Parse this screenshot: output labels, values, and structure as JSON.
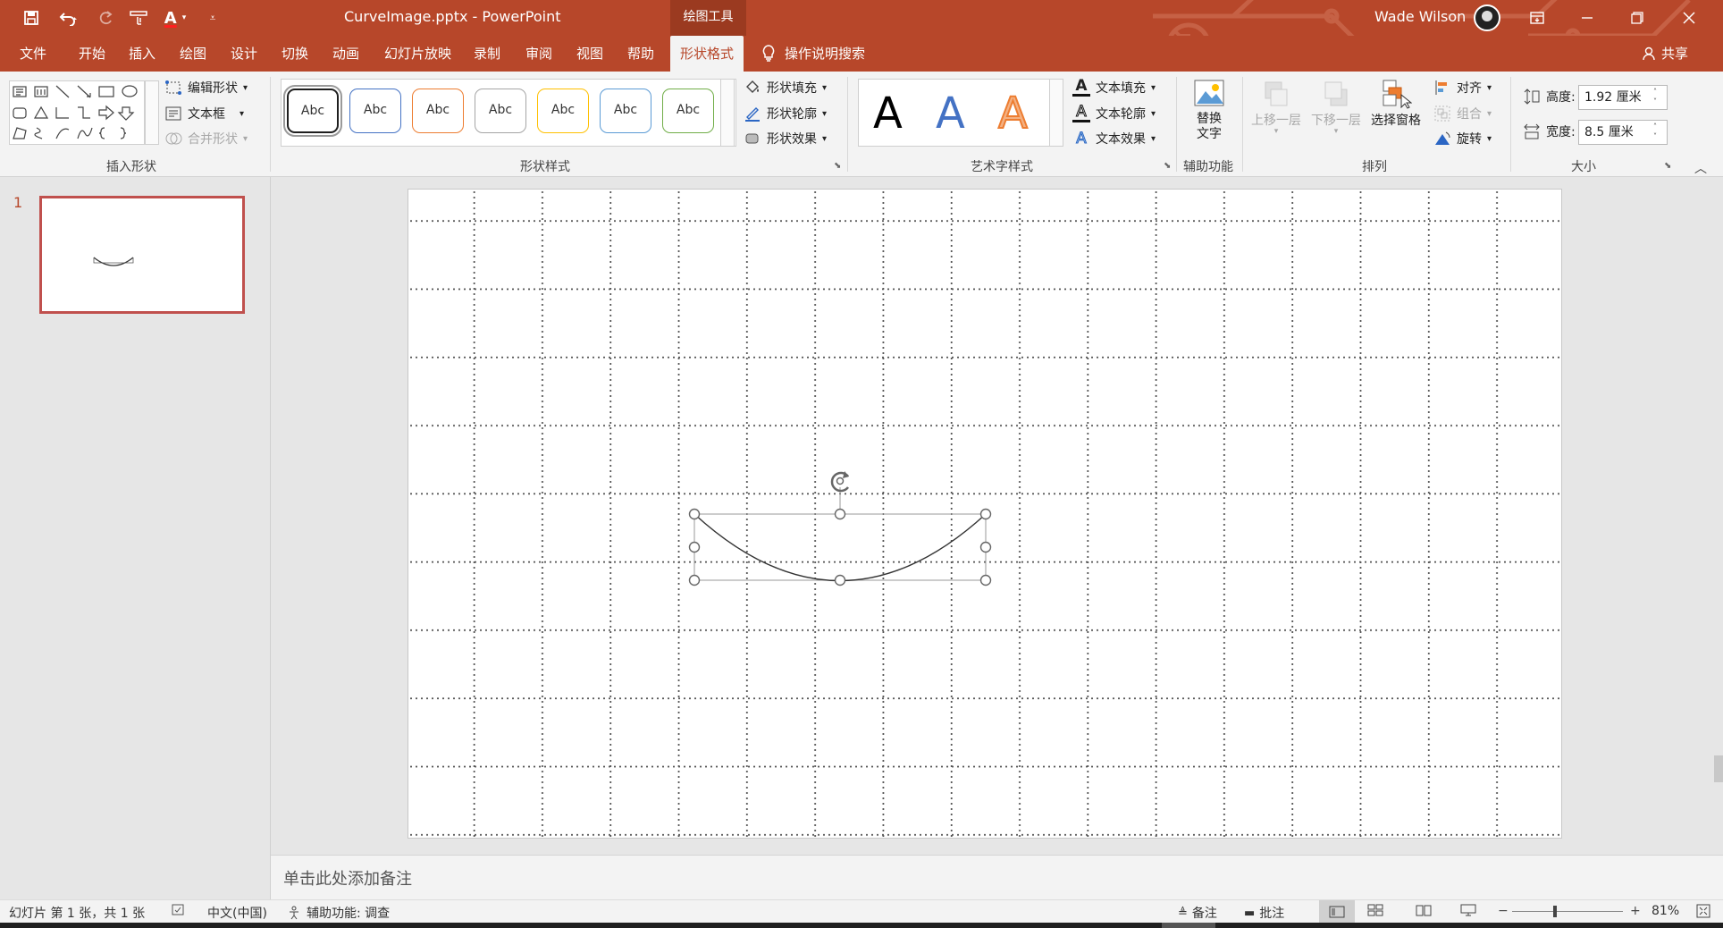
{
  "titlebar": {
    "doc_title": "CurveImage.pptx  -  PowerPoint",
    "context_tab": "绘图工具",
    "user_name": "Wade Wilson",
    "quick_access": [
      "save-icon",
      "undo-icon",
      "redo-icon",
      "touch-mode-icon",
      "font-color-icon",
      "customize-icon"
    ]
  },
  "tabs": [
    "文件",
    "开始",
    "插入",
    "绘图",
    "设计",
    "切换",
    "动画",
    "幻灯片放映",
    "录制",
    "审阅",
    "视图",
    "帮助",
    "形状格式"
  ],
  "active_tab": "形状格式",
  "tell_me": "操作说明搜索",
  "share": "共享",
  "ribbon": {
    "insert_shapes": {
      "label": "插入形状",
      "edit_shape": "编辑形状",
      "text_box": "文本框",
      "merge_shapes": "合并形状"
    },
    "shape_styles": {
      "label": "形状样式",
      "sample_text": "Abc",
      "style_colors": [
        "#1f1f1f",
        "#4472c4",
        "#ed7d31",
        "#a5a5a5",
        "#ffc000",
        "#5b9bd5",
        "#70ad47"
      ],
      "fill": "形状填充",
      "outline": "形状轮廓",
      "effects": "形状效果"
    },
    "wordart_styles": {
      "label": "艺术字样式",
      "letter": "A",
      "text_fill": "文本填充",
      "text_outline": "文本轮廓",
      "text_effects": "文本效果"
    },
    "accessibility": {
      "label": "辅助功能",
      "alt_text_line1": "替换",
      "alt_text_line2": "文字"
    },
    "arrange": {
      "label": "排列",
      "bring_forward": "上移一层",
      "send_backward": "下移一层",
      "selection_pane": "选择窗格",
      "align": "对齐",
      "group": "组合",
      "rotate": "旋转"
    },
    "size": {
      "label": "大小",
      "height_label": "高度:",
      "height_value": "1.92 厘米",
      "width_label": "宽度:",
      "width_value": "8.5 厘米"
    }
  },
  "thumbnail": {
    "number": "1"
  },
  "notes_placeholder": "单击此处添加备注",
  "status": {
    "slide_info": "幻灯片 第 1 张，共 1 张",
    "language": "中文(中国)",
    "accessibility": "辅助功能: 调查",
    "notes": "备注",
    "comments": "批注",
    "zoom": "81%"
  }
}
